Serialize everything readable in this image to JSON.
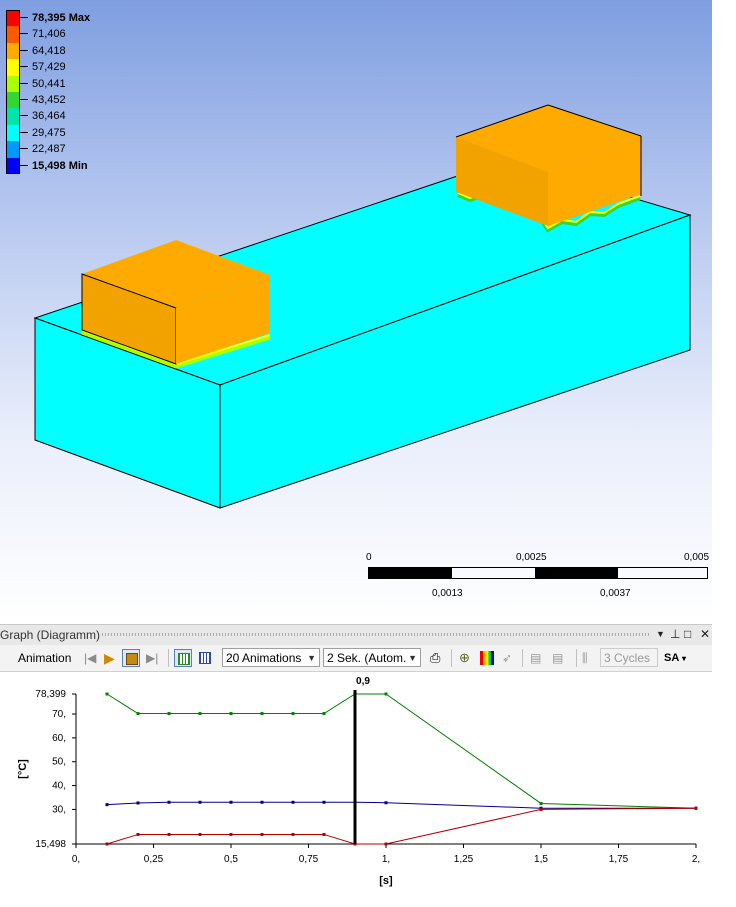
{
  "legend": {
    "entries": [
      {
        "label": "78,395 Max",
        "color": "#ff0000",
        "bold": true
      },
      {
        "label": "71,406",
        "color": "#ff5a00",
        "bold": false
      },
      {
        "label": "64,418",
        "color": "#ffaa00",
        "bold": false
      },
      {
        "label": "57,429",
        "color": "#ffff00",
        "bold": false
      },
      {
        "label": "50,441",
        "color": "#aaff00",
        "bold": false
      },
      {
        "label": "43,452",
        "color": "#33d633",
        "bold": false
      },
      {
        "label": "36,464",
        "color": "#00e6aa",
        "bold": false
      },
      {
        "label": "29,475",
        "color": "#00ffff",
        "bold": false
      },
      {
        "label": "22,487",
        "color": "#0099ff",
        "bold": false
      },
      {
        "label": "15,498 Min",
        "color": "#0000ff",
        "bold": true
      }
    ]
  },
  "colors": {
    "base": "#00ffff",
    "block": "#ffaa00",
    "edge_warm": "#aaff00",
    "edge_hot": "#ffff00"
  },
  "scale_bar": {
    "top_labels": [
      "0",
      "0,0025",
      "0,005"
    ],
    "bottom_labels": [
      "0,0013",
      "0,0037"
    ]
  },
  "panel": {
    "title": "Graph (Diagramm)",
    "icons": [
      "dropdown-icon",
      "pin-icon",
      "maximize-icon",
      "close-icon"
    ]
  },
  "toolbar": {
    "animation_label": "Animation",
    "frames_combo": "20 Animations",
    "duration_combo": "2 Sek. (Autom.",
    "cycles_label": "3 Cycles",
    "sa_label": "SA"
  },
  "chart_data": {
    "type": "line",
    "ylabel": "[°C]",
    "xlabel": "[s]",
    "xlim": [
      0,
      2
    ],
    "ylim": [
      15.498,
      78.399
    ],
    "y_ticks": [
      {
        "value": 78.399,
        "label": "78,399"
      },
      {
        "value": 70,
        "label": "70,"
      },
      {
        "value": 60,
        "label": "60,"
      },
      {
        "value": 50,
        "label": "50,"
      },
      {
        "value": 40,
        "label": "40,"
      },
      {
        "value": 30,
        "label": "30,"
      },
      {
        "value": 15.498,
        "label": "15,498"
      }
    ],
    "x_ticks": [
      {
        "value": 0,
        "label": "0,"
      },
      {
        "value": 0.25,
        "label": "0,25"
      },
      {
        "value": 0.5,
        "label": "0,5"
      },
      {
        "value": 0.75,
        "label": "0,75"
      },
      {
        "value": 1,
        "label": "1,"
      },
      {
        "value": 1.25,
        "label": "1,25"
      },
      {
        "value": 1.5,
        "label": "1,5"
      },
      {
        "value": 1.75,
        "label": "1,75"
      },
      {
        "value": 2,
        "label": "2,"
      }
    ],
    "marker": {
      "x": 0.9,
      "label": "0,9"
    },
    "x": [
      0.1,
      0.2,
      0.3,
      0.4,
      0.5,
      0.6,
      0.7,
      0.8,
      0.9,
      1.0,
      1.5,
      2.0
    ],
    "series": [
      {
        "color": "#008000",
        "values": [
          78.4,
          70.2,
          70.2,
          70.2,
          70.2,
          70.2,
          70.2,
          70.2,
          78.4,
          78.4,
          32.5,
          30.5
        ]
      },
      {
        "color": "#00008b",
        "values": [
          32.0,
          32.7,
          33.0,
          33.0,
          33.0,
          33.0,
          33.0,
          33.0,
          33.0,
          32.8,
          30.5,
          30.5
        ]
      },
      {
        "color": "#b00000",
        "values": [
          15.5,
          19.5,
          19.5,
          19.5,
          19.5,
          19.5,
          19.5,
          19.5,
          15.5,
          15.5,
          30.0,
          30.5
        ]
      }
    ]
  }
}
